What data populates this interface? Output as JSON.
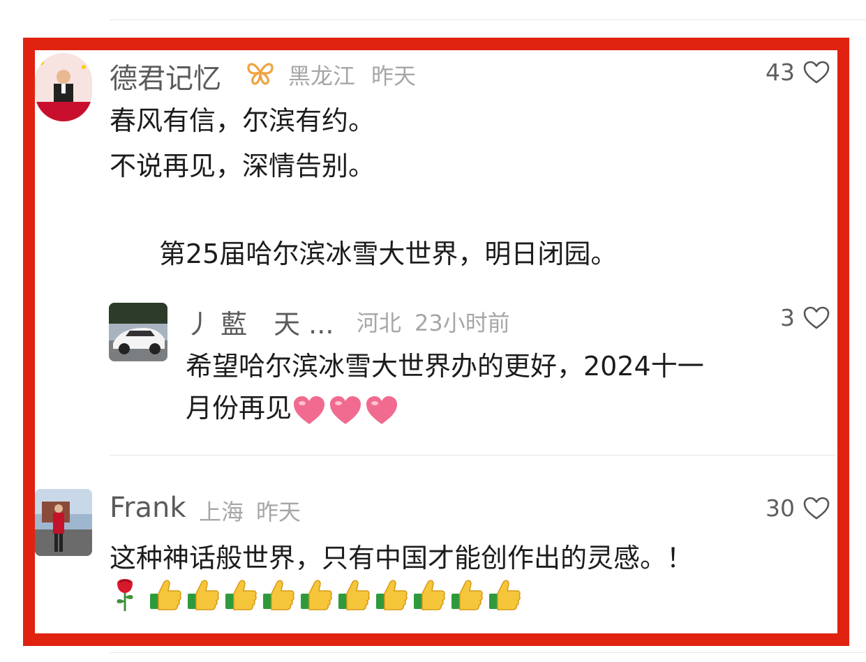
{
  "comments": [
    {
      "username": "德君记忆",
      "badge_icon": "vip-butterfly-badge-icon",
      "location": "黑龙江",
      "time": "昨天",
      "likes": "43",
      "text_lines": [
        "春风有信，尔滨有约。",
        "不说再见，深情告别。",
        "第25届哈尔滨冰雪大世界，明日闭园。"
      ],
      "reply": {
        "username": "丿 藍　天 ...",
        "location": "河北",
        "time": "23小时前",
        "likes": "3",
        "text_lines": [
          "希望哈尔滨冰雪大世界办的更好，2024十一",
          "月份再见"
        ],
        "emoji_icon": "pink-heart-emoji-icon"
      }
    },
    {
      "username": "Frank",
      "location": "上海",
      "time": "昨天",
      "likes": "30",
      "text_lines": [
        "这种神话般世界，只有中国才能创作出的灵感。！"
      ],
      "emoji_icons": [
        "rose-emoji-icon",
        "thumbs-up-emoji-icon"
      ]
    }
  ],
  "colors": {
    "highlight_border": "#e02210",
    "username": "#5a5a5a",
    "meta": "#a6a6a6",
    "body_text": "#1c1c1c",
    "vip_badge": "#f0a340",
    "emoji_heart": "#f06b8f",
    "emoji_thumb": "#f6c63a"
  }
}
